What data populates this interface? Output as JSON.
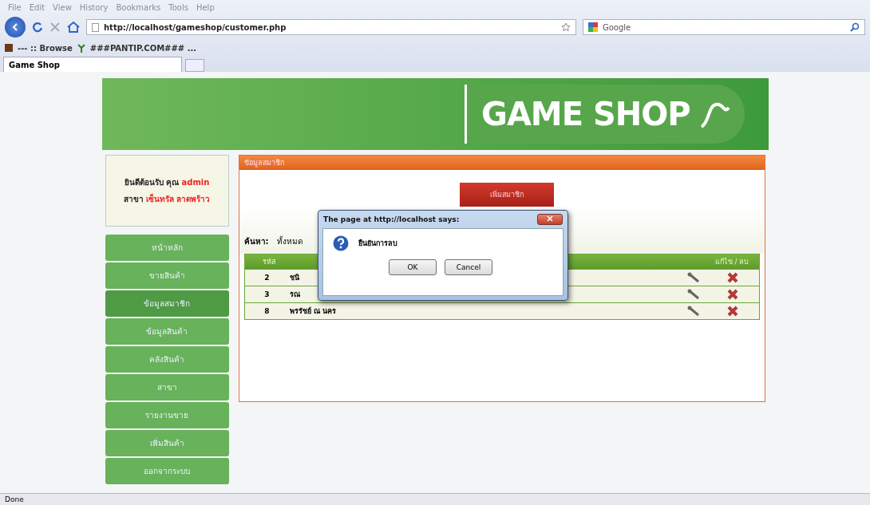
{
  "menu_bar": [
    "File",
    "Edit",
    "View",
    "History",
    "Bookmarks",
    "Tools",
    "Help"
  ],
  "address_bar": {
    "url": "http://localhost/gameshop/customer.php"
  },
  "search_box": {
    "engine": "Google"
  },
  "bookmarks": [
    "--- :: Browse",
    "###PANTIP.COM### ..."
  ],
  "tabs": [
    {
      "label": "Game Shop",
      "selected": true
    }
  ],
  "banner": {
    "logo": "GAME SHOP"
  },
  "welcome": {
    "greeting": "ยินดีต้อนรับ คุณ",
    "user": "admin",
    "branch_label": "สาขา",
    "branch": "เซ็นทรัล ลาดพร้าว"
  },
  "sidebar": {
    "items": [
      {
        "label": "หน้าหลัก",
        "selected": false
      },
      {
        "label": "ขายสินค้า",
        "selected": false
      },
      {
        "label": "ข้อมูลสมาชิก",
        "selected": true
      },
      {
        "label": "ข้อมูลสินค้า",
        "selected": false
      },
      {
        "label": "คลังสินค้า",
        "selected": false
      },
      {
        "label": "สาขา",
        "selected": false
      },
      {
        "label": "รายงานขาย",
        "selected": false
      },
      {
        "label": "เพิ่มสินค้า",
        "selected": false
      },
      {
        "label": "ออกจากระบบ",
        "selected": false
      }
    ]
  },
  "panel": {
    "title": "ข้อมูลสมาชิก",
    "add_button": "เพิ่มสมาชิก",
    "search_label": "ค้นหา:",
    "search_value": "ทั้งหมด",
    "table": {
      "columns": [
        "รหัส",
        "แก้ไข / ลบ"
      ],
      "rows": [
        {
          "code": "2",
          "name": "ชนิ"
        },
        {
          "code": "3",
          "name": "รณ"
        },
        {
          "code": "8",
          "name": "พรรัชย์ ณ นคร"
        }
      ]
    }
  },
  "dialog": {
    "title": "The page at http://localhost says:",
    "message": "ยืนยันการลบ",
    "buttons": [
      "OK",
      "Cancel"
    ]
  },
  "status_bar": "Done"
}
